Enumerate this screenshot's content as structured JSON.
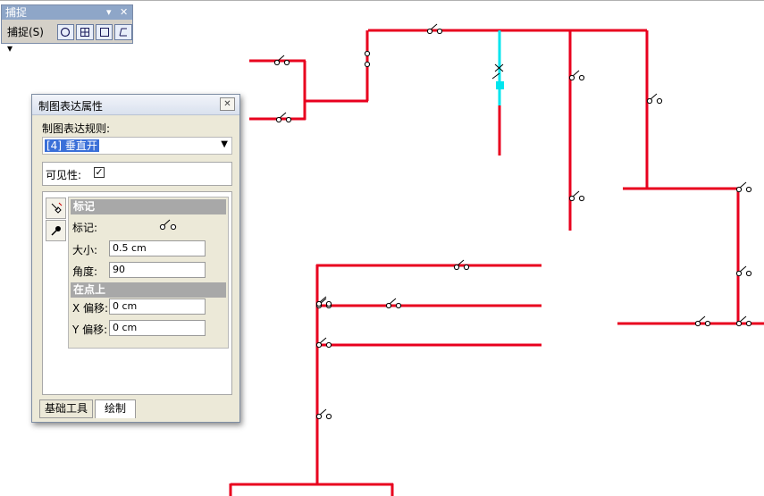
{
  "snap_toolbar": {
    "title": "捕捉",
    "menu_label": "捕捉(S)",
    "buttons": [
      {
        "icon": "snap-point-icon"
      },
      {
        "icon": "snap-end-icon"
      },
      {
        "icon": "snap-vertex-icon"
      },
      {
        "icon": "snap-edge-icon"
      }
    ]
  },
  "properties_window": {
    "title": "制图表达属性",
    "rule_label": "制图表达规则:",
    "rule_value": "[4] 垂直开",
    "visibility_label": "可见性:",
    "visibility_checked": true,
    "section_marker": "标记",
    "marker_label": "标记:",
    "size_label": "大小:",
    "size_value": "0.5 cm",
    "angle_label": "角度:",
    "angle_value": "90",
    "section_on_point": "在点上",
    "x_offset_label": "X 偏移:",
    "x_offset_value": "0 cm",
    "y_offset_label": "Y 偏移:",
    "y_offset_value": "0 cm",
    "tabs": [
      "基础工具",
      "绘制"
    ]
  },
  "colors": {
    "line": "#e8001e",
    "selected": "#00e5ee"
  }
}
